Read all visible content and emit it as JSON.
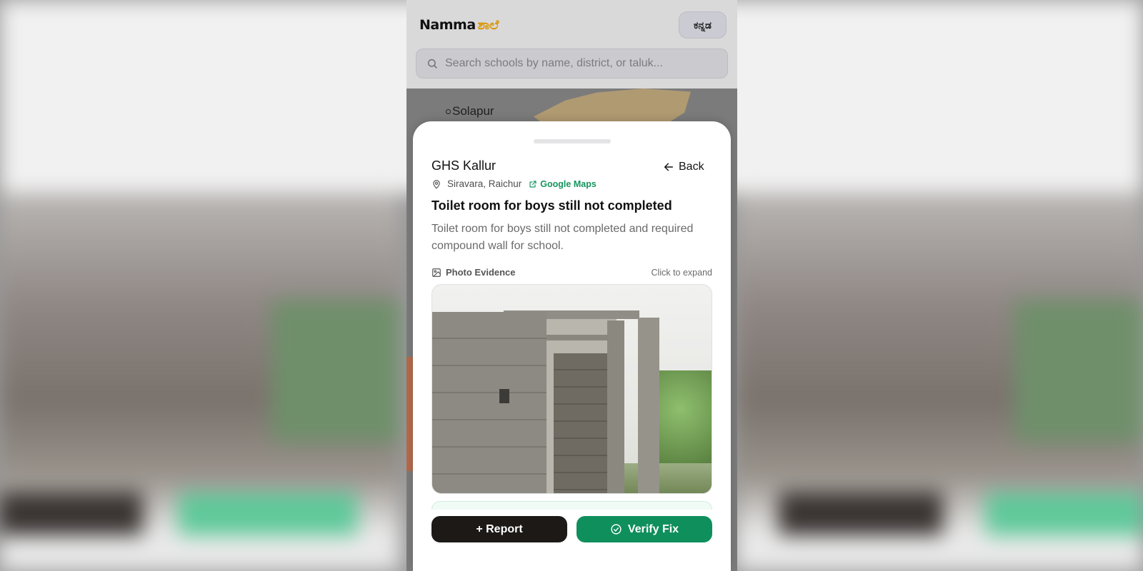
{
  "header": {
    "logo_main": "Namma",
    "logo_accent": "ಶಾಲೆ",
    "language_button": "ಕನ್ನಡ"
  },
  "search": {
    "placeholder": "Search schools by name, district, or taluk..."
  },
  "map": {
    "city_label": "Solapur"
  },
  "detail": {
    "school_name": "GHS Kallur",
    "location": "Siravara, Raichur",
    "maps_link": "Google Maps",
    "back_label": "Back",
    "issue_title": "Toilet room for boys still not completed",
    "issue_description": "Toilet room for boys still not completed and required compound wall for school.",
    "photo_label": "Photo Evidence",
    "photo_hint": "Click to expand"
  },
  "actions": {
    "report_label": "+ Report",
    "verify_label": "Verify Fix"
  },
  "colors": {
    "brand_accent": "#d99a12",
    "verify_green": "#0f8f5c",
    "report_dark": "#1c1917",
    "link_green": "#15965d"
  },
  "icons": [
    "search-icon",
    "map-pin-icon",
    "external-link-icon",
    "arrow-left-icon",
    "image-icon",
    "check-circle-icon"
  ]
}
